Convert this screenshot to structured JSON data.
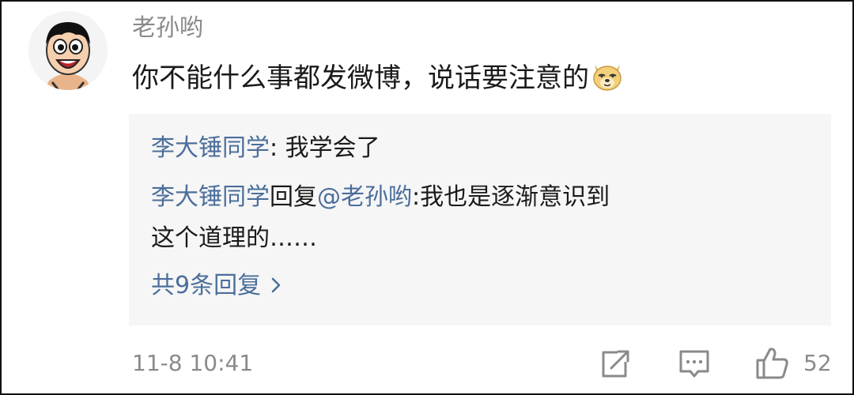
{
  "comment": {
    "username": "老孙哟",
    "text": "你不能什么事都发微博，说话要注意的",
    "avatar_icon": "cartoon-boy-avatar",
    "emoji_icon": "doge-emoji"
  },
  "replies": [
    {
      "author": "李大锤同学",
      "separator": ": ",
      "text": "我学会了"
    },
    {
      "author": "李大锤同学",
      "verb": "回复",
      "mention": "@老孙哟",
      "separator": ":",
      "text_line1": "我也是逐渐意识到",
      "text_line2": "这个道理的……"
    }
  ],
  "more_replies_label": "共9条回复",
  "footer": {
    "timestamp": "11-8 10:41",
    "like_count": "52",
    "icons": [
      "share-icon",
      "comment-icon",
      "like-icon"
    ]
  },
  "colors": {
    "link": "#4b6e9b",
    "meta_gray": "#8a8a8a",
    "reply_bg": "#f6f6f6",
    "text": "#1a1a1a"
  }
}
